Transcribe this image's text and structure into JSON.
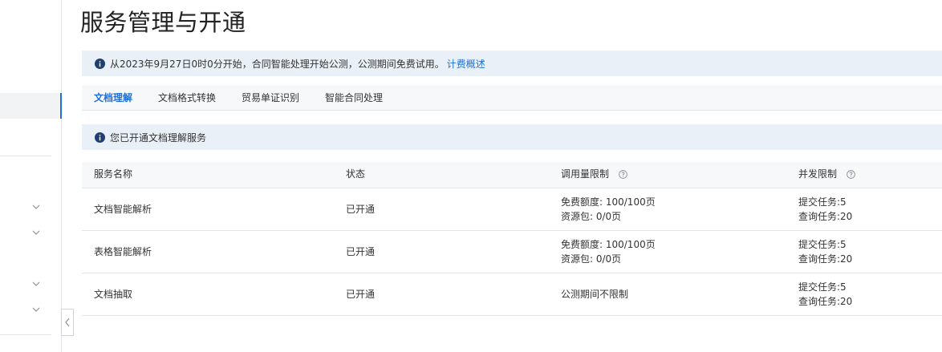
{
  "page": {
    "title": "服务管理与开通"
  },
  "notice": {
    "text": "从2023年9月27日0时0分开始，合同智能处理开始公测，公测期间免费试用。",
    "link": "计费概述"
  },
  "tabs": [
    "文档理解",
    "文档格式转换",
    "贸易单证识别",
    "智能合同处理"
  ],
  "status_notice": "您已开通文档理解服务",
  "table": {
    "headers": [
      "服务名称",
      "状态",
      "调用量限制",
      "并发限制"
    ],
    "rows": [
      {
        "name": "文档智能解析",
        "status": "已开通",
        "limit1": "免费额度: 100/100页",
        "limit2": "资源包: 0/0页",
        "conc1": "提交任务:5",
        "conc2": "查询任务:20"
      },
      {
        "name": "表格智能解析",
        "status": "已开通",
        "limit1": "免费额度: 100/100页",
        "limit2": "资源包: 0/0页",
        "conc1": "提交任务:5",
        "conc2": "查询任务:20"
      },
      {
        "name": "文档抽取",
        "status": "已开通",
        "limit1": "公测期间不限制",
        "conc1": "提交任务:5",
        "conc2": "查询任务:20"
      }
    ]
  },
  "colors": {
    "accent": "#1e6fd9",
    "notice_bg": "#eaf0f7",
    "header_bg": "#f7f8fa"
  },
  "icons": {
    "info": "info-icon",
    "help": "question-icon",
    "chevron": "chevron-down-icon",
    "collapse": "chevron-left-icon"
  }
}
